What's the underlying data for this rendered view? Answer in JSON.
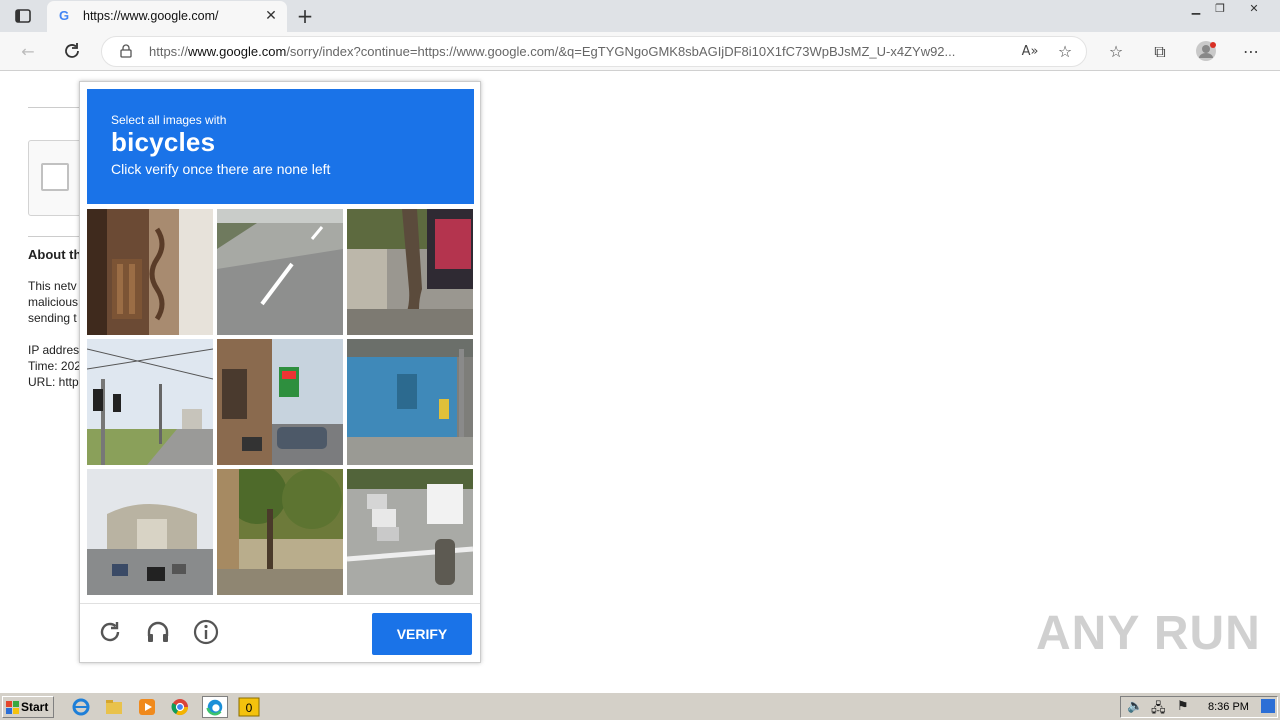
{
  "browser": {
    "tab_title": "https://www.google.com/",
    "address_host_prefix": "https://",
    "address_host": "www.google.com",
    "address_path": "/sorry/index?continue=https://www.google.com/&q=EgTYGNgoGMK8sbAGIjDF8i10X1fC73WpBJsMZ_U-x4ZYw92..."
  },
  "page": {
    "about_heading": "About th",
    "body_lines": [
      "This netv",
      "malicious",
      "sending t"
    ],
    "info_lines": [
      "IP addres",
      "Time: 202",
      "URL: http"
    ]
  },
  "captcha": {
    "prompt_pre": "Select all images with",
    "object": "bicycles",
    "prompt_post": "Click verify once there are none left",
    "verify_label": "VERIFY",
    "tiles": [
      "wooden-carving",
      "empty-road",
      "tree-sidewalk",
      "traffic-light-street",
      "storefront-street",
      "blue-kiosk",
      "gateway-arch-road",
      "trees-sidewalk",
      "busy-crosswalk"
    ]
  },
  "watermark": "ANY RUN",
  "taskbar": {
    "start_label": "Start",
    "clock": "8:36 PM"
  },
  "colors": {
    "accent": "#1a73e8"
  }
}
